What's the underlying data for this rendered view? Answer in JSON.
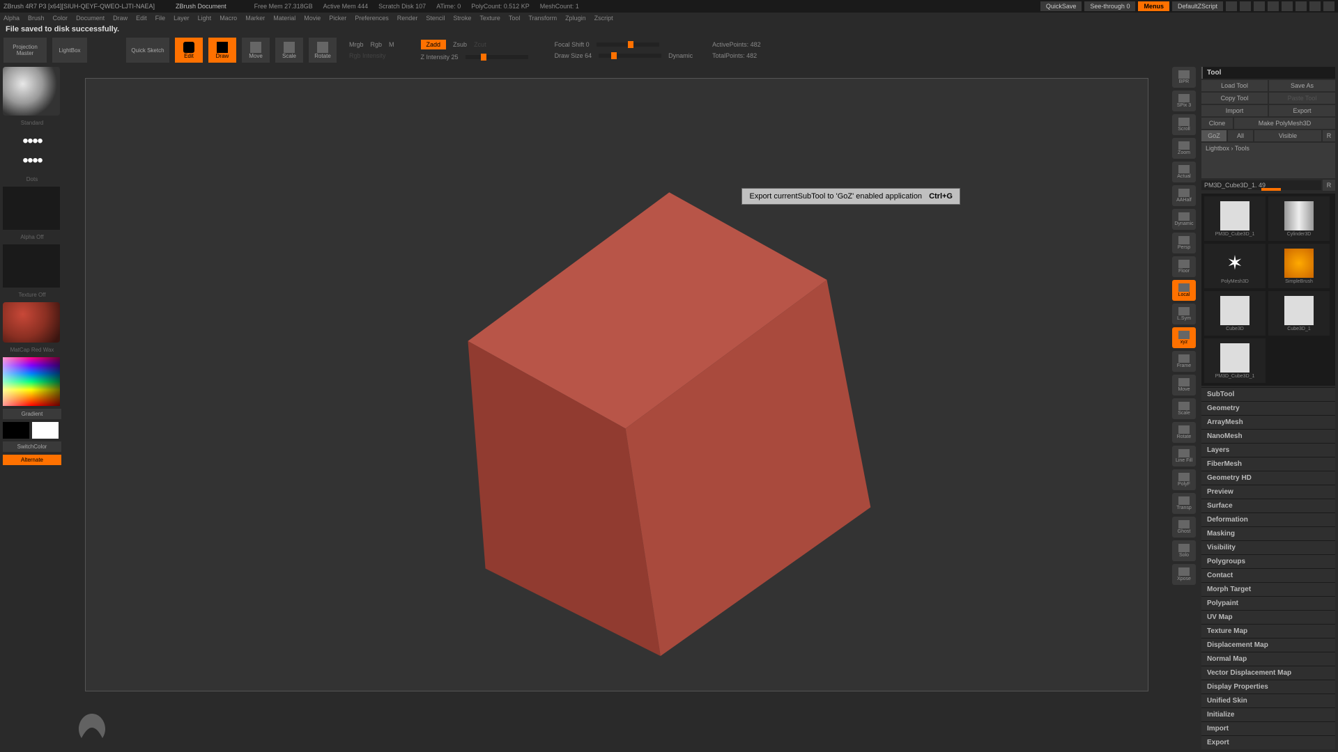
{
  "title_bar": {
    "app": "ZBrush 4R7 P3 [x64][SIUH-QEYF-QWEO-LJTI-NAEA]",
    "doc": "ZBrush Document",
    "stats": {
      "free_mem": "Free Mem 27.318GB",
      "active_mem": "Active Mem 444",
      "scratch": "Scratch Disk 107",
      "atime": "ATime: 0",
      "poly": "PolyCount: 0.512 KP",
      "mesh": "MeshCount: 1"
    },
    "quicksave": "QuickSave",
    "seethrough": "See-through  0",
    "menus": "Menus",
    "script": "DefaultZScript"
  },
  "menu": [
    "Alpha",
    "Brush",
    "Color",
    "Document",
    "Draw",
    "Edit",
    "File",
    "Layer",
    "Light",
    "Macro",
    "Marker",
    "Material",
    "Movie",
    "Picker",
    "Preferences",
    "Render",
    "Stencil",
    "Stroke",
    "Texture",
    "Tool",
    "Transform",
    "Zplugin",
    "Zscript"
  ],
  "status": "File saved to disk successfully.",
  "toolbar": {
    "projection": "Projection Master",
    "lightbox": "LightBox",
    "quicksketch": "Quick Sketch",
    "edit": "Edit",
    "draw": "Draw",
    "move": "Move",
    "scale": "Scale",
    "rotate": "Rotate",
    "mrgb": "Mrgb",
    "rgb": "Rgb",
    "m": "M",
    "rgb_intensity": "Rgb Intensity",
    "zadd": "Zadd",
    "zsub": "Zsub",
    "zcut": "Zcut",
    "z_intensity": "Z Intensity 25",
    "focal_shift": "Focal Shift 0",
    "draw_size": "Draw Size 64",
    "dynamic": "Dynamic",
    "active_points": "ActivePoints: 482",
    "total_points": "TotalPoints: 482"
  },
  "left": {
    "brush_label": "Standard",
    "stroke_label": "Dots",
    "alpha_label": "Alpha Off",
    "texture_label": "Texture Off",
    "material_label": "MatCap Red Wax",
    "gradient": "Gradient",
    "switchcolor": "SwitchColor",
    "alternate": "Alternate"
  },
  "shelf": [
    "BPR",
    "SPix 3",
    "Scroll",
    "Zoom",
    "Actual",
    "AAHalf",
    "Dynamic",
    "Persp",
    "Floor",
    "Local",
    "L.Sym",
    "xyz",
    "Frame",
    "Move",
    "Scale",
    "Rotate",
    "Line Fill",
    "PolyF",
    "Transp",
    "Ghost",
    "Solo",
    "Xpose"
  ],
  "tooltip": {
    "text": "Export currentSubTool to 'GoZ' enabled application",
    "shortcut": "Ctrl+G"
  },
  "right": {
    "header": "Tool",
    "load": "Load Tool",
    "save": "Save As",
    "copy": "Copy Tool",
    "paste": "Paste Tool",
    "import": "Import",
    "export": "Export",
    "clone": "Clone",
    "makepoly": "Make PolyMesh3D",
    "goz": "GoZ",
    "all": "All",
    "visible": "Visible",
    "r1": "R",
    "lightbox_tools": "Lightbox › Tools",
    "tool_name": "PM3D_Cube3D_1. 49",
    "r2": "R",
    "thumbs": [
      "PM3D_Cube3D_1",
      "Cylinder3D",
      "PolyMesh3D",
      "SimpleBrush",
      "Cube3D",
      "Cube3D_1",
      "PM3D_Cube3D_1"
    ],
    "accordion": [
      "SubTool",
      "Geometry",
      "ArrayMesh",
      "NanoMesh",
      "Layers",
      "FiberMesh",
      "Geometry HD",
      "Preview",
      "Surface",
      "Deformation",
      "Masking",
      "Visibility",
      "Polygroups",
      "Contact",
      "Morph Target",
      "Polypaint",
      "UV Map",
      "Texture Map",
      "Displacement Map",
      "Normal Map",
      "Vector Displacement Map",
      "Display Properties",
      "Unified Skin",
      "Initialize",
      "Import",
      "Export"
    ]
  }
}
